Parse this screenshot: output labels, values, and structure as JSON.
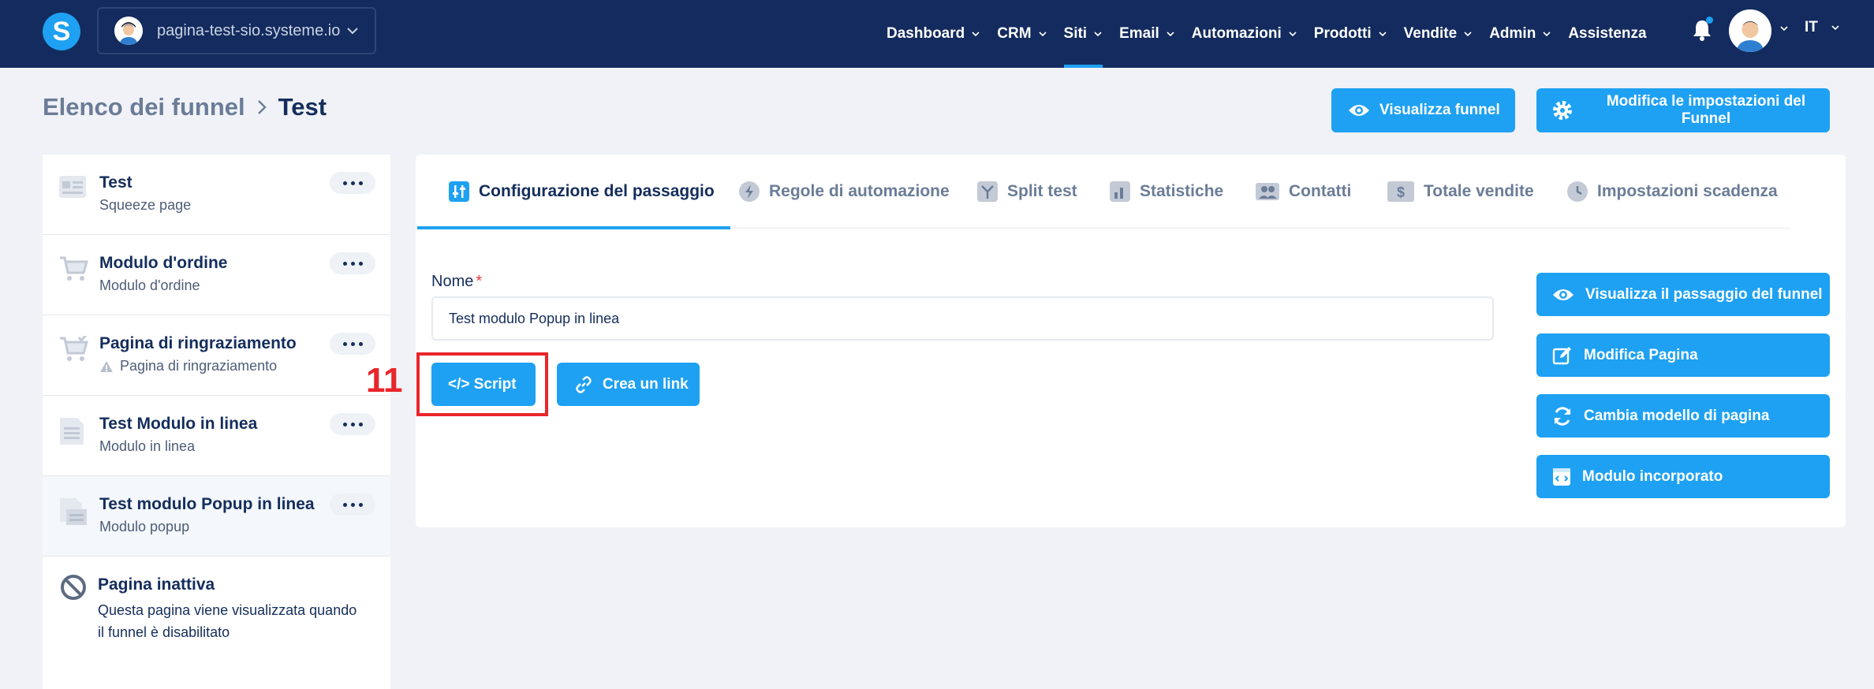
{
  "topbar": {
    "logo_letter": "S",
    "site_name": "pagina-test-sio.systeme.io",
    "nav": [
      {
        "label": "Dashboard"
      },
      {
        "label": "CRM"
      },
      {
        "label": "Siti"
      },
      {
        "label": "Email"
      },
      {
        "label": "Automazioni"
      },
      {
        "label": "Prodotti"
      },
      {
        "label": "Vendite"
      },
      {
        "label": "Admin"
      },
      {
        "label": "Assistenza"
      }
    ],
    "active_nav": "Siti",
    "language": "IT"
  },
  "header": {
    "breadcrumb_root": "Elenco dei funnel",
    "breadcrumb_current": "Test",
    "view_funnel_label": "Visualizza funnel",
    "edit_settings_label": "Modifica le impostazioni del Funnel"
  },
  "sidebar": {
    "steps": [
      {
        "title": "Test",
        "subtitle": "Squeeze page",
        "icon": "squeeze-page-icon"
      },
      {
        "title": "Modulo d'ordine",
        "subtitle": "Modulo d'ordine",
        "icon": "cart-icon"
      },
      {
        "title": "Pagina di ringraziamento",
        "subtitle": "Pagina di ringraziamento",
        "icon": "cart-check-icon",
        "warning": true
      },
      {
        "title": "Test Modulo in linea",
        "subtitle": "Modulo in linea",
        "icon": "inline-form-icon"
      },
      {
        "title": "Test modulo Popup in linea",
        "subtitle": "Modulo popup",
        "icon": "popup-form-icon",
        "selected": true
      }
    ],
    "inactive": {
      "title": "Pagina inattiva",
      "description": "Questa pagina viene visualizzata quando il funnel è disabilitato"
    }
  },
  "main": {
    "tabs": [
      {
        "label": "Configurazione del passaggio",
        "icon": "config-icon",
        "active": true
      },
      {
        "label": "Regole di automazione",
        "icon": "lightning-icon"
      },
      {
        "label": "Split test",
        "icon": "split-icon"
      },
      {
        "label": "Statistiche",
        "icon": "chart-icon"
      },
      {
        "label": "Contatti",
        "icon": "contacts-icon"
      },
      {
        "label": "Totale vendite",
        "icon": "dollar-icon"
      },
      {
        "label": "Impostazioni scadenza",
        "icon": "clock-icon"
      }
    ],
    "name_label": "Nome",
    "name_required_mark": "*",
    "name_value": "Test modulo Popup in linea",
    "script_label": "</> Script",
    "link_label": "Crea un link",
    "annotation_number": "11",
    "side_actions": [
      {
        "label": "Visualizza il passaggio del funnel",
        "icon": "eye-icon"
      },
      {
        "label": "Modifica Pagina",
        "icon": "edit-icon"
      },
      {
        "label": "Cambia modello di pagina",
        "icon": "refresh-icon"
      },
      {
        "label": "Modulo incorporato",
        "icon": "embed-icon"
      }
    ]
  },
  "colors": {
    "topbar": "#132b5e",
    "accent": "#1ea1f2",
    "highlight": "#e8262b",
    "text": "#142d5c"
  }
}
